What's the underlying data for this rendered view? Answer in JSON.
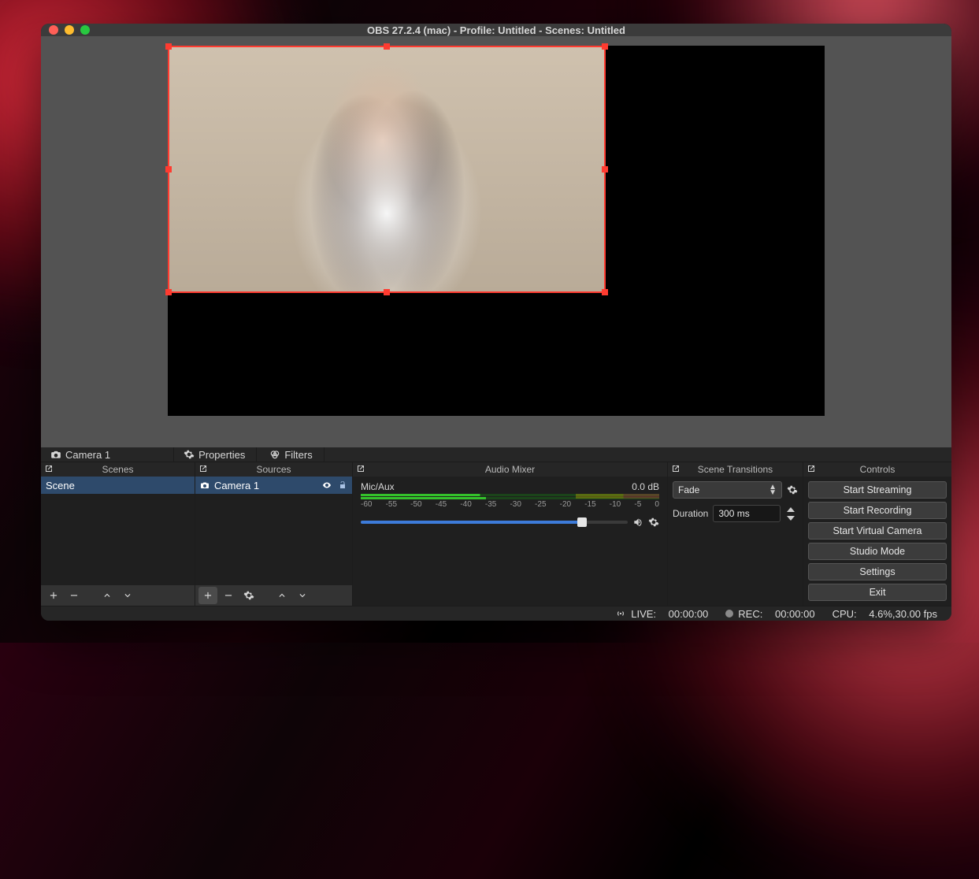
{
  "window": {
    "title": "OBS 27.2.4 (mac) - Profile: Untitled - Scenes: Untitled"
  },
  "context": {
    "selected_source": "Camera 1",
    "properties_label": "Properties",
    "filters_label": "Filters"
  },
  "panels": {
    "scenes": {
      "title": "Scenes",
      "items": [
        "Scene"
      ]
    },
    "sources": {
      "title": "Sources",
      "items": [
        {
          "name": "Camera 1",
          "visible": true,
          "locked": false
        }
      ]
    },
    "mixer": {
      "title": "Audio Mixer",
      "channel": {
        "name": "Mic/Aux",
        "level_db": "0.0 dB"
      },
      "ticks": [
        "-60",
        "-55",
        "-50",
        "-45",
        "-40",
        "-35",
        "-30",
        "-25",
        "-20",
        "-15",
        "-10",
        "-5",
        "0"
      ]
    },
    "transitions": {
      "title": "Scene Transitions",
      "selected": "Fade",
      "duration_label": "Duration",
      "duration_value": "300 ms"
    },
    "controls": {
      "title": "Controls",
      "buttons": [
        "Start Streaming",
        "Start Recording",
        "Start Virtual Camera",
        "Studio Mode",
        "Settings",
        "Exit"
      ]
    }
  },
  "status": {
    "live_label": "LIVE:",
    "live_time": "00:00:00",
    "rec_label": "REC:",
    "rec_time": "00:00:00",
    "cpu_label": "CPU:",
    "cpu_value": "4.6%,30.00 fps"
  }
}
